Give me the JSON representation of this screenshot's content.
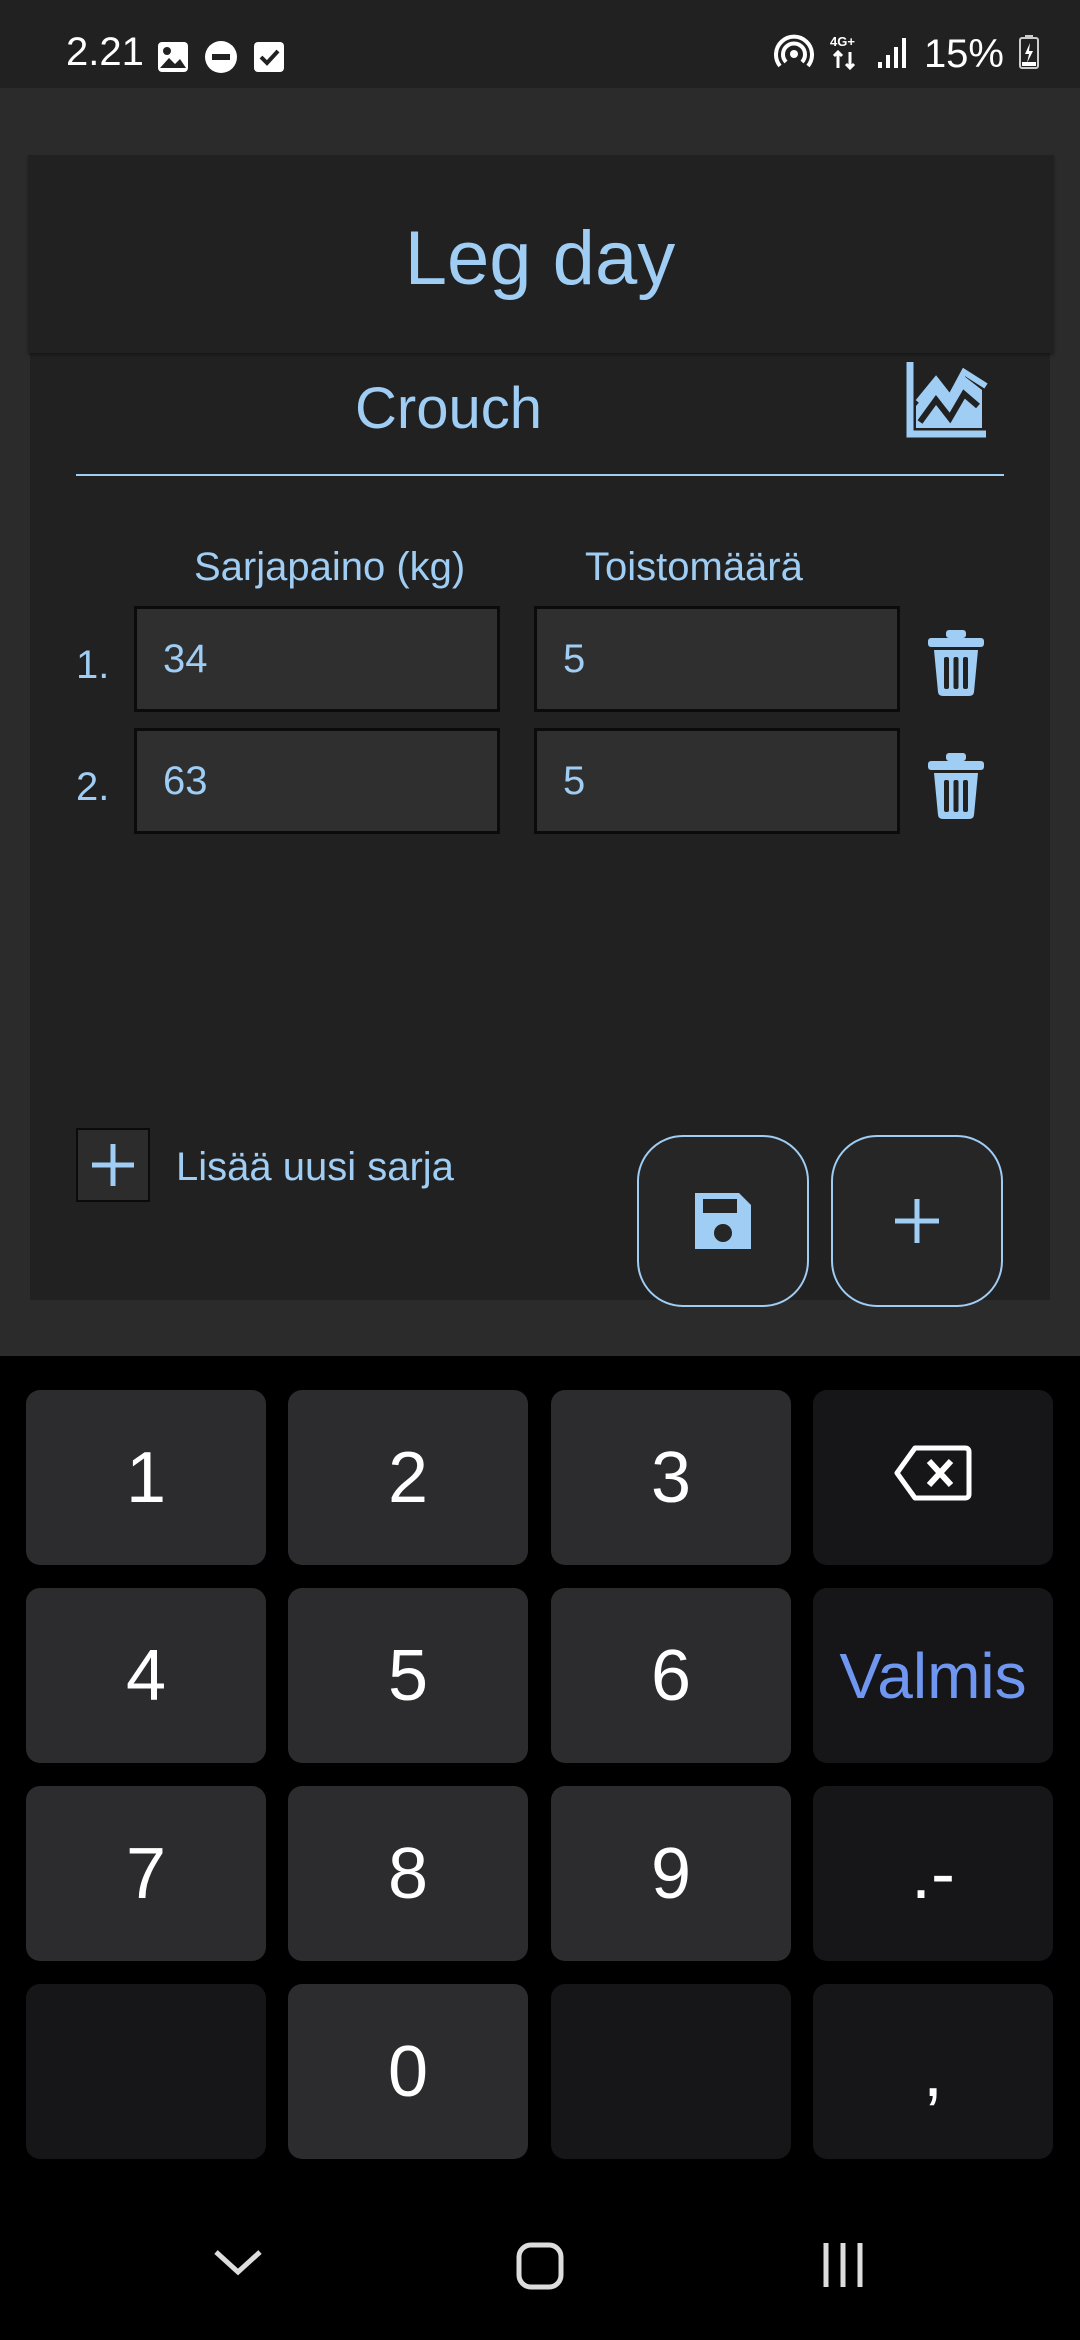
{
  "status_bar": {
    "time": "2.21",
    "battery": "15%",
    "icons_left": [
      "image-icon",
      "do-not-disturb-icon",
      "checkbox-icon"
    ],
    "icons_right": [
      "hotspot-icon",
      "network-4g-plus-icon",
      "signal-icon",
      "battery-charging-icon"
    ]
  },
  "workout": {
    "title": "Leg day",
    "exercise": "Crouch",
    "chart_icon": "chart-area-icon"
  },
  "sets_table": {
    "columns": [
      "Sarjapaino (kg)",
      "Toistomäärä"
    ],
    "rows": [
      {
        "index": "1.",
        "weight": "34",
        "reps": "5"
      },
      {
        "index": "2.",
        "weight": "63",
        "reps": "5"
      }
    ]
  },
  "actions": {
    "add_set_label": "Lisää uusi sarja",
    "save_icon": "save-icon",
    "add_icon": "plus-icon"
  },
  "keypad": {
    "keys": [
      "1",
      "2",
      "3",
      "4",
      "5",
      "6",
      "7",
      "8",
      "9",
      "0",
      ".-",
      ","
    ],
    "done_label": "Valmis",
    "backspace_icon": "backspace-icon"
  },
  "navigation": {
    "icons": [
      "back-chevron-icon",
      "home-icon",
      "recents-icon"
    ]
  },
  "colors": {
    "accent": "#9fcdf4",
    "keypad_done": "#6f96f0",
    "background": "#212121"
  }
}
